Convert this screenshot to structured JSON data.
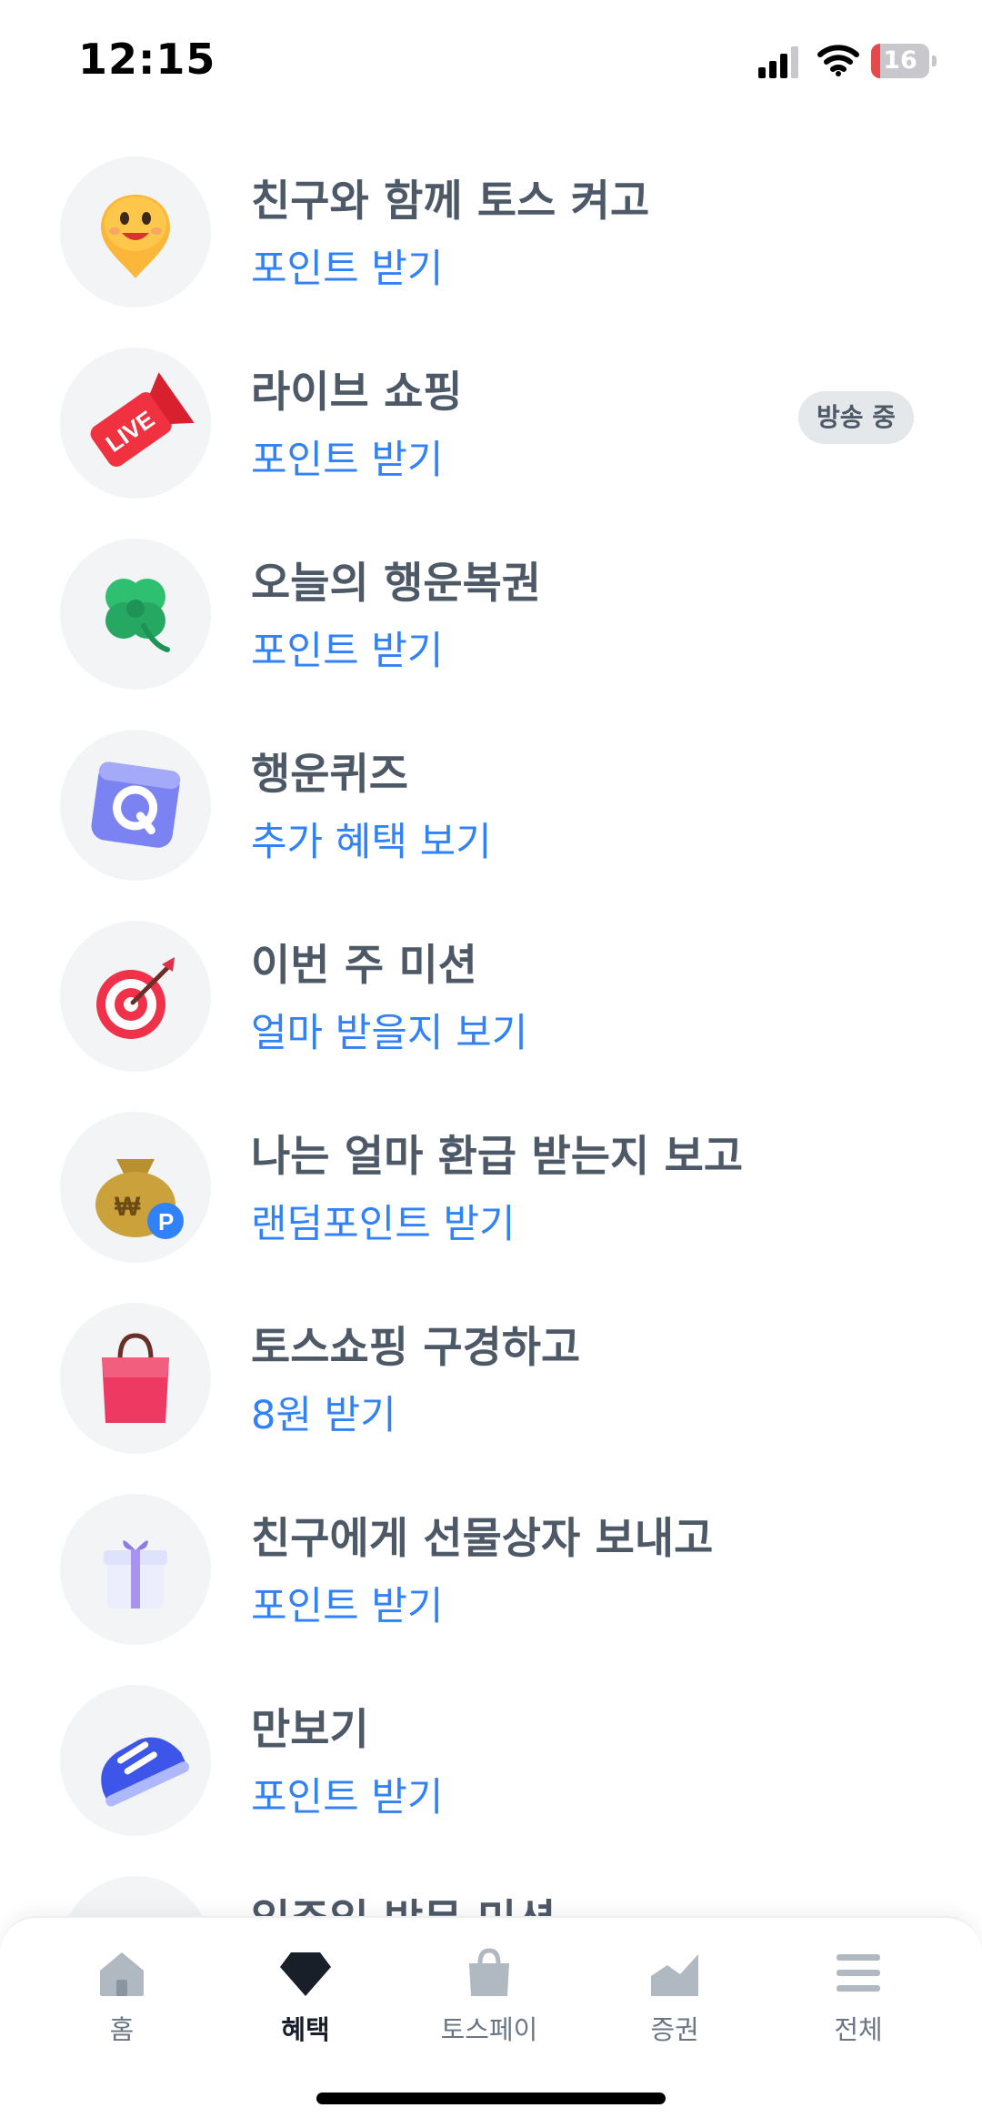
{
  "status_bar": {
    "time": "12:15",
    "battery_level": "16",
    "battery_fraction": 0.16,
    "icons": [
      "cellular-signal-icon",
      "wifi-icon",
      "battery-icon"
    ]
  },
  "colors": {
    "accent": "#3182f6",
    "title": "#4e5968",
    "icon_bg": "#f2f4f6",
    "badge_bg": "#e5e8eb"
  },
  "benefits": [
    {
      "title": "친구와 함께 토스 켜고",
      "subtitle": "포인트 받기",
      "icon": "smiley-location-pin-icon"
    },
    {
      "title": "라이브 쇼핑",
      "subtitle": "포인트 받기",
      "icon": "live-megaphone-icon",
      "badge": "방송 중"
    },
    {
      "title": "오늘의 행운복권",
      "subtitle": "포인트 받기",
      "icon": "four-leaf-clover-icon"
    },
    {
      "title": "행운퀴즈",
      "subtitle": "추가 혜택 보기",
      "icon": "quiz-q-block-icon"
    },
    {
      "title": "이번 주 미션",
      "subtitle": "얼마 받을지 보기",
      "icon": "target-dart-icon"
    },
    {
      "title": "나는 얼마 환급 받는지 보고",
      "subtitle": "랜덤포인트 받기",
      "icon": "money-bag-icon"
    },
    {
      "title": "토스쇼핑 구경하고",
      "subtitle": "8원 받기",
      "icon": "shopping-bag-icon"
    },
    {
      "title": "친구에게 선물상자 보내고",
      "subtitle": "포인트 받기",
      "icon": "gift-box-icon"
    },
    {
      "title": "만보기",
      "subtitle": "포인트 받기",
      "icon": "sneaker-icon"
    },
    {
      "title": "일주일 방문 미션",
      "subtitle": "",
      "icon": "calendar-icon"
    }
  ],
  "bottom_nav": [
    {
      "label": "홈",
      "icon": "home-icon",
      "active": false
    },
    {
      "label": "혜택",
      "icon": "gem-icon",
      "active": true
    },
    {
      "label": "토스페이",
      "icon": "shopping-bag-icon",
      "active": false
    },
    {
      "label": "증권",
      "icon": "chart-icon",
      "active": false
    },
    {
      "label": "전체",
      "icon": "menu-icon",
      "active": false
    }
  ]
}
